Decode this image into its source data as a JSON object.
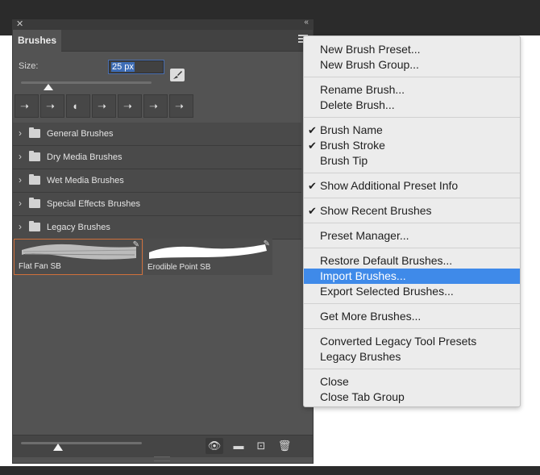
{
  "panel": {
    "tab_label": "Brushes",
    "size_label": "Size:",
    "size_value": "25 px",
    "size_slider_fraction": 0.2,
    "brush_tips": [
      "tip1",
      "tip2",
      "tip3",
      "tip4",
      "tip5",
      "tip6",
      "tip7"
    ],
    "groups": [
      "General Brushes",
      "Dry Media Brushes",
      "Wet Media Brushes",
      "Special Effects Brushes",
      "Legacy Brushes"
    ],
    "presets": [
      "Flat Fan SB",
      "Erodible Point SB"
    ],
    "footer_icons": [
      "eye-icon",
      "new-group-icon",
      "new-brush-icon",
      "trash-icon"
    ],
    "preview_slider_fraction": 0.3
  },
  "menu": {
    "items": [
      {
        "label": "New Brush Preset...",
        "checked": false
      },
      {
        "label": "New Brush Group...",
        "checked": false
      },
      {
        "label": "Rename Brush...",
        "checked": false
      },
      {
        "label": "Delete Brush...",
        "checked": false
      },
      {
        "label": "Brush Name",
        "checked": true
      },
      {
        "label": "Brush Stroke",
        "checked": true
      },
      {
        "label": "Brush Tip",
        "checked": false
      },
      {
        "label": "Show Additional Preset Info",
        "checked": true
      },
      {
        "label": "Show Recent Brushes",
        "checked": true
      },
      {
        "label": "Preset Manager...",
        "checked": false
      },
      {
        "label": "Restore Default Brushes...",
        "checked": false
      },
      {
        "label": "Import Brushes...",
        "checked": false,
        "highlighted": true
      },
      {
        "label": "Export Selected Brushes...",
        "checked": false
      },
      {
        "label": "Get More Brushes...",
        "checked": false
      },
      {
        "label": "Converted Legacy Tool Presets",
        "checked": false
      },
      {
        "label": "Legacy Brushes",
        "checked": false
      },
      {
        "label": "Close",
        "checked": false
      },
      {
        "label": "Close Tab Group",
        "checked": false
      }
    ]
  },
  "colors": {
    "highlight": "#3f8ae9",
    "selection_border": "#d0703b",
    "panel_bg": "#535353"
  }
}
